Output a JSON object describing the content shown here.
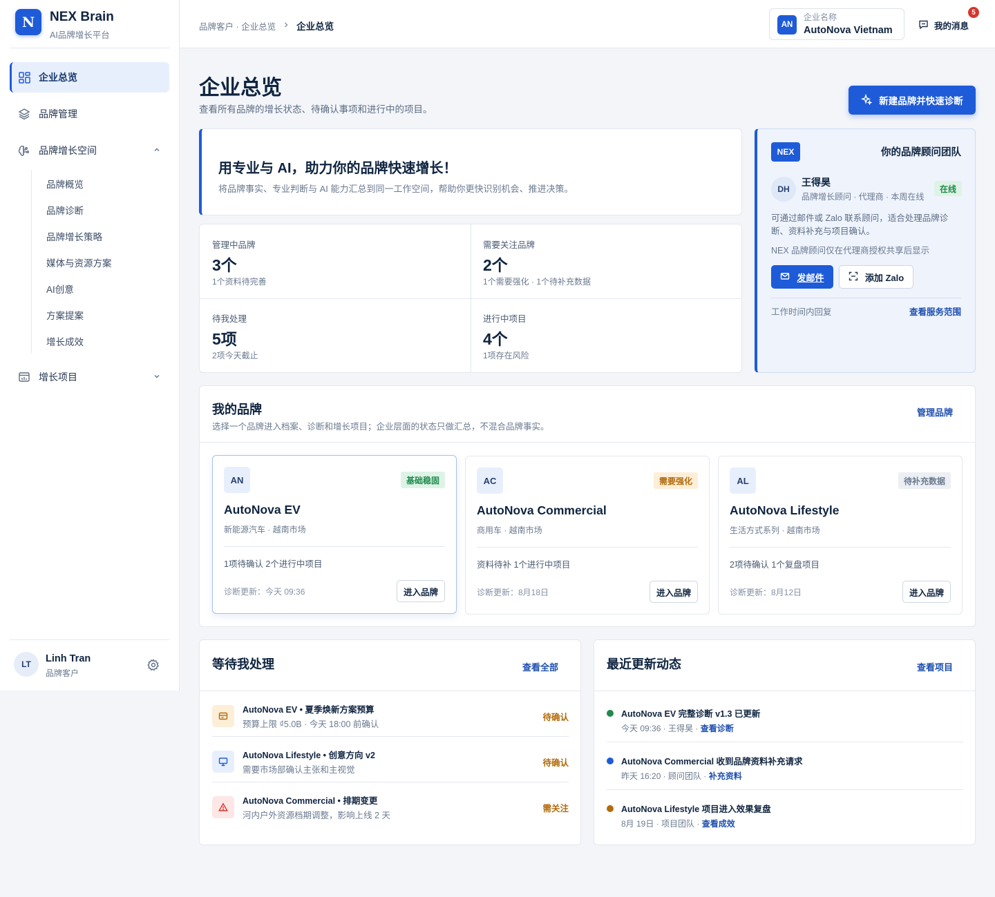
{
  "app": {
    "logo_letter": "N",
    "name": "NEX Brain",
    "subtitle": "AI品牌增长平台"
  },
  "nav": {
    "items": [
      {
        "label": "企业总览",
        "icon": "dashboard-icon",
        "active": true
      },
      {
        "label": "品牌管理",
        "icon": "layers-icon"
      },
      {
        "label": "品牌增长空间",
        "icon": "brain-icon",
        "expanded": true
      },
      {
        "label": "增长项目",
        "icon": "calendar-icon",
        "expanded": false
      }
    ],
    "sub_items": [
      "品牌概览",
      "品牌诊断",
      "品牌增长策略",
      "媒体与资源方案",
      "AI创意",
      "方案提案",
      "增长成效"
    ]
  },
  "user": {
    "initials": "LT",
    "name": "Linh Tran",
    "role": "品牌客户",
    "icon": "gear-icon"
  },
  "topbar": {
    "breadcrumb_parent": "品牌客户 · 企业总览",
    "breadcrumb_current": "企业总览",
    "company_initials": "AN",
    "company_label": "企业名称",
    "company_name": "AutoNova Vietnam",
    "messages_label": "我的消息",
    "messages_count": "5"
  },
  "page": {
    "title": "企业总览",
    "subtitle": "查看所有品牌的增长状态、待确认事项和进行中的项目。",
    "primary_button": "新建品牌并快速诊断"
  },
  "hero": {
    "title": "用专业与 AI，助力你的品牌快速增长！",
    "subtitle": "将品牌事实、专业判断与 AI 能力汇总到同一工作空间，帮助你更快识别机会、推进决策。"
  },
  "stats": [
    {
      "label": "管理中品牌",
      "value": "3个",
      "note": "1个资料待完善"
    },
    {
      "label": "需要关注品牌",
      "value": "2个",
      "note": "1个需要强化 · 1个待补充数据"
    },
    {
      "label": "待我处理",
      "value": "5项",
      "note": "2项今天截止"
    },
    {
      "label": "进行中项目",
      "value": "4个",
      "note": "1项存在风险"
    }
  ],
  "advisor": {
    "tag": "NEX",
    "title": "你的品牌顾问团队",
    "initials": "DH",
    "name": "王得昊",
    "role": "品牌增长顾问 · 代理商 · 本周在线",
    "status": "在线",
    "description": "可通过邮件或 Zalo 联系顾问，适合处理品牌诊断、资料补充与项目确认。",
    "note": "NEX 品牌顾问仅在代理商授权共享后显示",
    "email_button": "发邮件",
    "zalo_button": "添加 Zalo",
    "hours": "工作时间内回复",
    "scope_link": "查看服务范围"
  },
  "brands": {
    "title": "我的品牌",
    "subtitle": "选择一个品牌进入档案、诊断和增长项目；企业层面的状态只做汇总，不混合品牌事实。",
    "manage_link": "管理品牌",
    "items": [
      {
        "initials": "AN",
        "status": "基础稳固",
        "name": "AutoNova EV",
        "category": "新能源汽车 · 越南市场",
        "stats": "1项待确认   2个进行中项目",
        "updated": "诊断更新：今天 09:36",
        "enter": "进入品牌",
        "status_color": "#1f8a4c",
        "status_bg": "#def3e6"
      },
      {
        "initials": "AC",
        "status": "需要强化",
        "name": "AutoNova Commercial",
        "category": "商用车 · 越南市场",
        "stats": "资料待补   1个进行中项目",
        "updated": "诊断更新：8月18日",
        "enter": "进入品牌",
        "status_color": "#b26b0c",
        "status_bg": "#fdeed8"
      },
      {
        "initials": "AL",
        "status": "待补充数据",
        "name": "AutoNova Lifestyle",
        "category": "生活方式系列 · 越南市场",
        "stats": "2项待确认   1个复盘项目",
        "updated": "诊断更新：8月12日",
        "enter": "进入品牌",
        "status_color": "#6b7a90",
        "status_bg": "#eceff3"
      }
    ]
  },
  "pending": {
    "title": "等待我处理",
    "link": "查看全部",
    "items": [
      {
        "icon": "budget-icon",
        "title": "AutoNova EV • 夏季焕新方案预算",
        "sub": "预算上限 ₫5.0B · 今天 18:00 前确认",
        "status": "待确认"
      },
      {
        "icon": "presentation-icon",
        "title": "AutoNova Lifestyle • 创意方向 v2",
        "sub": "需要市场部确认主张和主视觉",
        "status": "待确认"
      },
      {
        "icon": "warning-icon",
        "title": "AutoNova Commercial • 排期变更",
        "sub": "河内户外资源档期调整，影响上线 2 天",
        "status": "需关注"
      }
    ]
  },
  "updates": {
    "title": "最近更新动态",
    "link": "查看项目",
    "items": [
      {
        "title": "AutoNova EV 完整诊断 v1.3 已更新",
        "meta": "今天 09:36 · 王得昊 · ",
        "link": "查看诊断",
        "dot": "#1f8a4c"
      },
      {
        "title": "AutoNova Commercial 收到品牌资料补充请求",
        "meta": "昨天 16:20 · 顾问团队 · ",
        "link": "补充资料",
        "dot": "#1e5bd8"
      },
      {
        "title": "AutoNova Lifestyle 项目进入效果复盘",
        "meta": "8月 19日 · 项目团队 · ",
        "link": "查看成效",
        "dot": "#b26b0c"
      }
    ]
  },
  "colors": {
    "accent": "#1e5bd8",
    "success": "#1f8a4c",
    "warning": "#b26b0c",
    "danger": "#d6362e"
  }
}
